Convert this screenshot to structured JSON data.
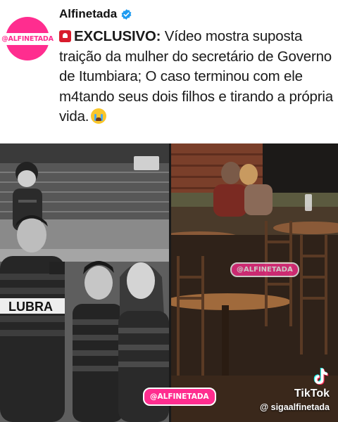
{
  "post": {
    "avatar_text": "@ALFINETADA",
    "account_name": "Alfinetada",
    "verified": true,
    "lead": "EXCLUSIVO:",
    "text": " Vídeo mostra suposta traição da mulher do secretário de Governo de Itumbiara; O caso terminou com ele m4tando seus dois filhos e tirando a própria vida.",
    "lead_icon": "siren-icon",
    "end_emoji": "crying-face-icon"
  },
  "media": {
    "left_photo": "family-stadium-photo",
    "right_photo": "restaurant-couple-photo",
    "watermark_text": "@ALFINETADA",
    "tiktok_name": "TikTok",
    "tiktok_handle": "@ sigaalfinetada"
  },
  "colors": {
    "brand_pink": "#ff2d8f",
    "verified_blue": "#1d9bf0",
    "siren_red": "#d81b2c",
    "text": "#1a1a1a"
  }
}
